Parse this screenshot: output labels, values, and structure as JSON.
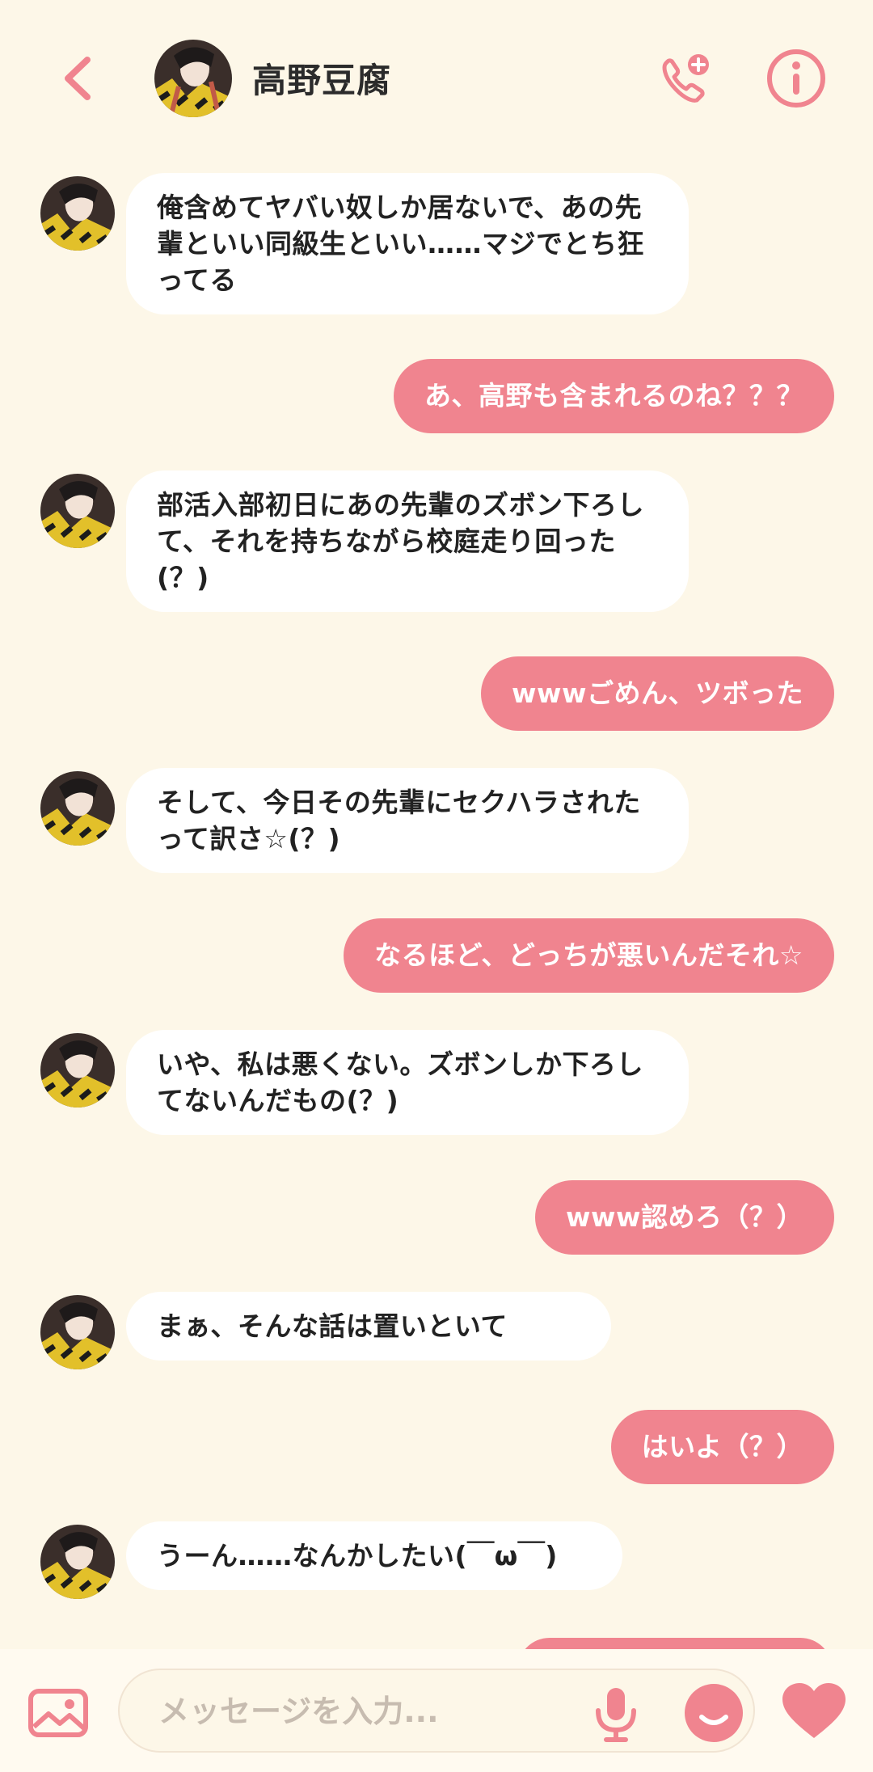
{
  "header": {
    "contact_name": "高野豆腐"
  },
  "messages": [
    {
      "side": "in",
      "text": "俺含めてヤバい奴しか居ないで、あの先輩といい同級生といい……マジでとち狂ってる"
    },
    {
      "side": "out",
      "text": "あ、高野も含まれるのね？？？"
    },
    {
      "side": "in",
      "text": "部活入部初日にあの先輩のズボン下ろして、それを持ちながら校庭走り回った(？)"
    },
    {
      "side": "out",
      "text": "wwwごめん、ツボった"
    },
    {
      "side": "in",
      "text": "そして、今日その先輩にセクハラされたって訳さ☆(？)"
    },
    {
      "side": "out",
      "text": "なるほど、どっちが悪いんだそれ☆"
    },
    {
      "side": "in",
      "text": "いや、私は悪くない。ズボンしか下ろしてないんだもの(？)"
    },
    {
      "side": "out",
      "text": "www認めろ（？）"
    },
    {
      "side": "in",
      "text": "まぁ、そんな話は置いといて"
    },
    {
      "side": "out",
      "text": "はいよ（？）"
    },
    {
      "side": "in",
      "text": "うーん……なんかしたい(￣ω￣)"
    }
  ],
  "composer": {
    "placeholder": "メッセージを入力..."
  },
  "icons": {
    "back": "chevron-left-icon",
    "call": "phone-add-icon",
    "info": "info-icon",
    "image": "image-icon",
    "mic": "mic-icon",
    "emoji": "emoji-icon",
    "heart": "heart-icon"
  },
  "colors": {
    "accent": "#f0848f",
    "background": "#fdf7e8",
    "incoming_bubble": "#ffffff"
  }
}
